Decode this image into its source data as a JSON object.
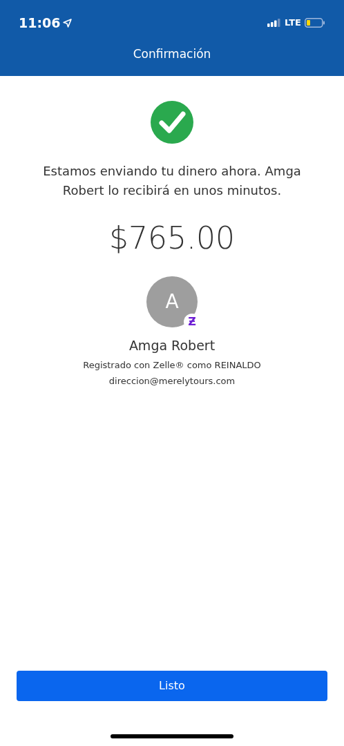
{
  "status_bar": {
    "time": "11:06",
    "network": "LTE"
  },
  "header": {
    "title": "Confirmación"
  },
  "message": "Estamos enviando tu dinero ahora. Amga Robert  lo recibirá en unos minutos.",
  "amount": "$765.00",
  "recipient": {
    "initial": "A",
    "badge": "Ƶ",
    "name": "Amga Robert",
    "registration": "Registrado con Zelle® como REINALDO",
    "email": "direccion@merelytours.com"
  },
  "button": "Listo"
}
